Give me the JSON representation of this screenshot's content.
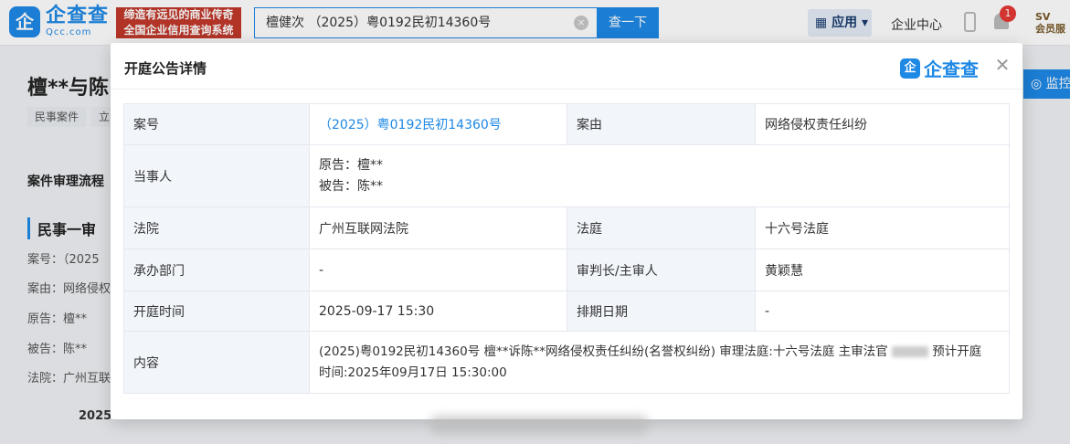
{
  "header": {
    "logo_mark": "企",
    "logo_cn": "企查查",
    "logo_en": "Qcc.com",
    "slogan_line1": "缔造有远见的商业传奇",
    "slogan_line2": "全国企业信用查询系统",
    "search_value": "檀健次 （2025）粤0192民初14360号",
    "search_button": "查一下",
    "app_button": "应用",
    "enterprise_center": "企业中心",
    "notification_count": "1",
    "vip_line1": "SV",
    "vip_line2": "会员服"
  },
  "background_page": {
    "title": "檀**与陈",
    "tags": [
      "民事案件",
      "立"
    ],
    "monitor_button": "监控",
    "process_heading": "案件审理流程",
    "stage_title": "民事一审",
    "side_lines": [
      "案号：（2025",
      "案由：网络侵权",
      "原告：檀**",
      "被告：陈**",
      "法院：广州互联"
    ],
    "bottom_date": "2025"
  },
  "modal": {
    "title": "开庭公告详情",
    "logo_mark": "企",
    "logo_text": "企查查",
    "rows": [
      {
        "l1": "案号",
        "v1": "（2025）粤0192民初14360号",
        "l2": "案由",
        "v2": "网络侵权责任纠纷"
      },
      {
        "l1": "当事人",
        "plaintiff": "原告：檀**",
        "defendant": "被告：陈**"
      },
      {
        "l1": "法院",
        "v1": "广州互联网法院",
        "l2": "法庭",
        "v2": "十六号法庭"
      },
      {
        "l1": "承办部门",
        "v1": "-",
        "l2": "审判长/主审人",
        "v2": "黄颖慧"
      },
      {
        "l1": "开庭时间",
        "v1": "2025-09-17 15:30",
        "l2": "排期日期",
        "v2": "-"
      },
      {
        "l1": "内容",
        "content_a": "(2025)粤0192民初14360号 檀**诉陈**网络侵权责任纠纷(名誉权纠纷) 审理法庭:十六号法庭 主审法官",
        "content_b": "预计开庭",
        "content_c": "时间:2025年09月17日 15:30:00"
      }
    ]
  }
}
